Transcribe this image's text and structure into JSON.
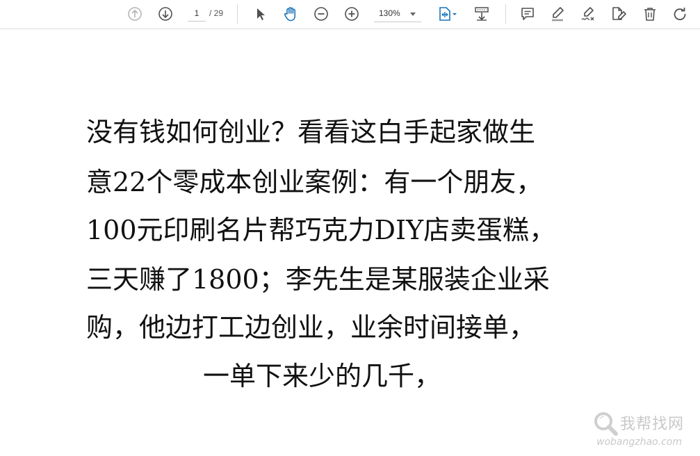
{
  "toolbar": {
    "page_current": "1",
    "page_total": "/ 29",
    "zoom": "130%",
    "icons": [
      "previous-page-icon",
      "next-page-icon",
      "select-tool-icon",
      "hand-tool-icon",
      "zoom-out-icon",
      "zoom-in-icon",
      "fit-page-icon",
      "scroll-mode-icon",
      "comment-icon",
      "highlight-icon",
      "sign-icon",
      "edit-icon",
      "delete-icon",
      "rotate-icon"
    ],
    "accent_color": "#1a73b8"
  },
  "document": {
    "lines": [
      "没有钱如何创业？看看这白手起家做生",
      "意22个零成本创业案例：有一个朋友，",
      "100元印刷名片帮巧克力DIY店卖蛋糕，",
      "三天赚了1800；李先生是某服装企业采",
      "购，他边打工边创业，业余时间接单，",
      "一单下来少的几千，"
    ]
  },
  "watermark": {
    "title": "我帮找网",
    "subtitle": "wobangzhao.com"
  }
}
